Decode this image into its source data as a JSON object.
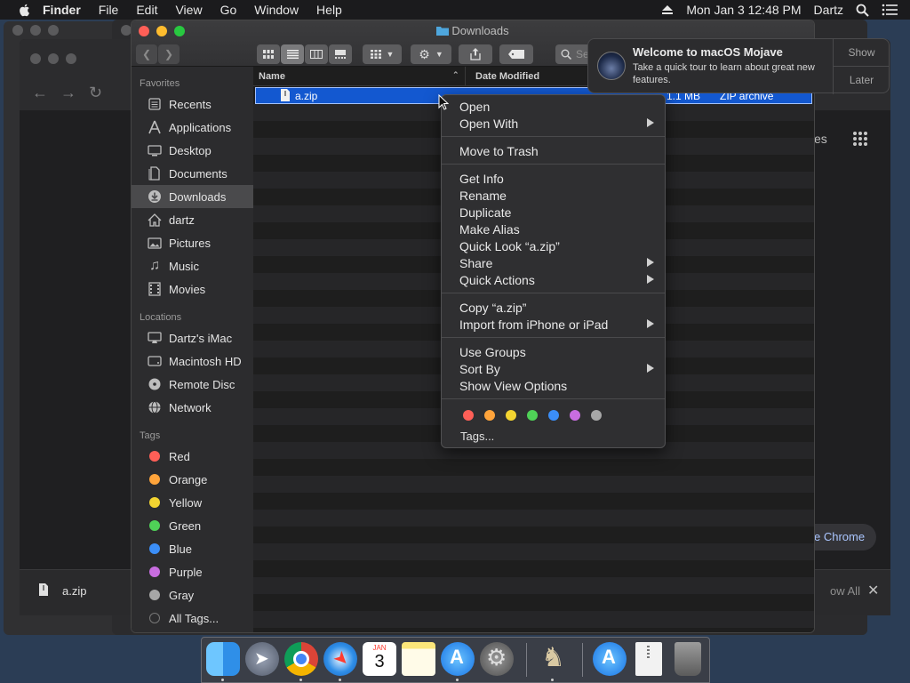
{
  "menubar": {
    "items": [
      "Finder",
      "File",
      "Edit",
      "View",
      "Go",
      "Window",
      "Help"
    ],
    "datetime": "Mon Jan 3  12:48 PM",
    "user": "Dartz"
  },
  "finder": {
    "title": "Downloads",
    "search_placeholder": "Se",
    "sidebar": {
      "favorites_title": "Favorites",
      "favorites": [
        "Recents",
        "Applications",
        "Desktop",
        "Documents",
        "Downloads",
        "dartz",
        "Pictures",
        "Music",
        "Movies"
      ],
      "locations_title": "Locations",
      "locations": [
        "Dartz's iMac",
        "Macintosh HD",
        "Remote Disc",
        "Network"
      ],
      "tags_title": "Tags",
      "tags": [
        {
          "label": "Red",
          "color": "#ff5f57"
        },
        {
          "label": "Orange",
          "color": "#ffa43b"
        },
        {
          "label": "Yellow",
          "color": "#f3d431"
        },
        {
          "label": "Green",
          "color": "#4fd157"
        },
        {
          "label": "Blue",
          "color": "#3b8ef7"
        },
        {
          "label": "Purple",
          "color": "#c86de0"
        },
        {
          "label": "Gray",
          "color": "#a7a7a7"
        }
      ],
      "all_tags": "All Tags..."
    },
    "columns": {
      "name": "Name",
      "date_modified": "Date Modified"
    },
    "file": {
      "name": "a.zip",
      "size": "1.1 MB",
      "kind": "ZIP archive"
    }
  },
  "context_menu": {
    "groups": [
      [
        {
          "label": "Open"
        },
        {
          "label": "Open With",
          "submenu": true
        }
      ],
      [
        {
          "label": "Move to Trash"
        }
      ],
      [
        {
          "label": "Get Info"
        },
        {
          "label": "Rename"
        },
        {
          "label": "Duplicate"
        },
        {
          "label": "Make Alias"
        },
        {
          "label": "Quick Look “a.zip”"
        },
        {
          "label": "Share",
          "submenu": true
        },
        {
          "label": "Quick Actions",
          "submenu": true
        }
      ],
      [
        {
          "label": "Copy “a.zip”"
        },
        {
          "label": "Import from iPhone or iPad",
          "submenu": true
        }
      ],
      [
        {
          "label": "Use Groups"
        },
        {
          "label": "Sort By",
          "submenu": true
        },
        {
          "label": "Show View Options"
        }
      ]
    ],
    "tag_colors": [
      "#ff5f57",
      "#ffa43b",
      "#f3d431",
      "#4fd157",
      "#3b8ef7",
      "#c86de0",
      "#a7a7a7"
    ],
    "tags_item": "Tags..."
  },
  "notification": {
    "title": "Welcome to macOS Mojave",
    "body": "Take a quick tour to learn about great new features.",
    "show": "Show",
    "later": "Later"
  },
  "chrome_bg": {
    "download_file": "a.zip",
    "show_all": "ow All",
    "chrome_btn": "e Chrome",
    "partial_text": "es"
  },
  "dock": {
    "icons": [
      "finder-icon",
      "launchpad-icon",
      "chrome-icon",
      "safari-icon",
      "calendar-icon",
      "notes-icon",
      "app-store-icon",
      "system-preferences-icon",
      "chess-icon",
      "app-store-downloads-icon",
      "zip-file-icon",
      "trash-icon"
    ],
    "calendar_month": "JAN",
    "calendar_day": "3"
  }
}
